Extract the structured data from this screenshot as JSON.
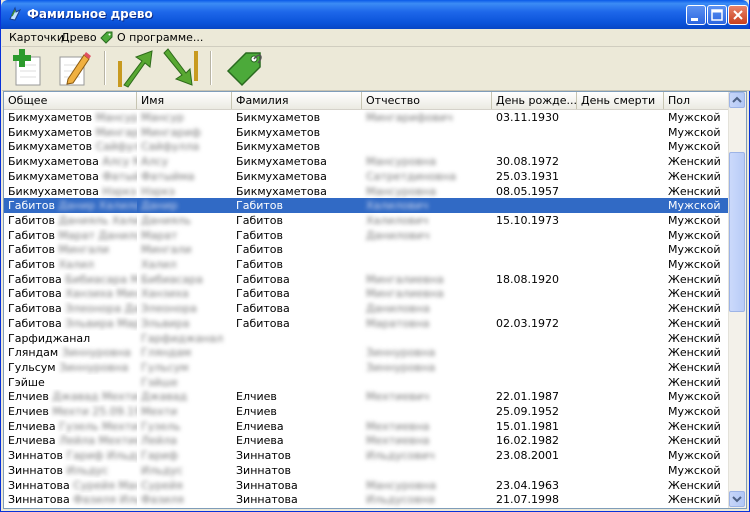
{
  "window": {
    "title": "Фамильное древо",
    "colors": {
      "titlebar": "#0a52d9",
      "selection": "#316ac5"
    }
  },
  "menu": {
    "cards": "Карточки",
    "tree": "Древо",
    "about": "О программе..."
  },
  "toolbar": {
    "buttons": [
      "add-card-icon",
      "edit-card-icon",
      "move-up-icon",
      "move-down-icon",
      "tag-icon"
    ]
  },
  "table": {
    "columns": [
      "Общее",
      "Имя",
      "Фамилия",
      "Отчество",
      "День рожде...",
      "День смерти",
      "Пол"
    ],
    "rows": [
      {
        "general": "Бикмухаметов Мансур",
        "name": "Мансур",
        "surname": "Бикмухаметов",
        "patronymic": "Мингарифович",
        "birth": "03.11.1930",
        "death": "",
        "sex": "Мужской"
      },
      {
        "general": "Бикмухаметов Мингариф",
        "name": "Мингариф",
        "surname": "Бикмухаметов",
        "patronymic": "",
        "birth": "",
        "death": "",
        "sex": "Мужской"
      },
      {
        "general": "Бикмухаметов Сайфулла",
        "name": "Сайфулла",
        "surname": "Бикмухаметов",
        "patronymic": "",
        "birth": "",
        "death": "",
        "sex": "Мужской"
      },
      {
        "general": "Бикмухаметова Алсу Мансуровна",
        "name": "Алсу",
        "surname": "Бикмухаметова",
        "patronymic": "Мансуровна",
        "birth": "30.08.1972",
        "death": "",
        "sex": "Женский"
      },
      {
        "general": "Бикмухаметова Фатыйма",
        "name": "Фатыйма",
        "surname": "Бикмухаметова",
        "patronymic": "Сатретдиновна",
        "birth": "25.03.1931",
        "death": "",
        "sex": "Женский"
      },
      {
        "general": "Бикмухаметова Нэркэ",
        "name": "Нэркэ",
        "surname": "Бикмухаметова",
        "patronymic": "Мансуровна",
        "birth": "08.05.1957",
        "death": "",
        "sex": "Женский"
      },
      {
        "general": "Габитов Данир Халилович",
        "name": "Данир",
        "surname": "Габитов",
        "patronymic": "Халилович",
        "birth": "",
        "death": "",
        "sex": "Мужской"
      },
      {
        "general": "Габитов Данияль Халилович",
        "name": "Данияль",
        "surname": "Габитов",
        "patronymic": "Халилович",
        "birth": "15.10.1973",
        "death": "",
        "sex": "Мужской"
      },
      {
        "general": "Габитов Марат Данилович",
        "name": "Марат",
        "surname": "Габитов",
        "patronymic": "Данилович",
        "birth": "",
        "death": "",
        "sex": "Мужской"
      },
      {
        "general": "Габитов Мингали",
        "name": "Мингали",
        "surname": "Габитов",
        "patronymic": "",
        "birth": "",
        "death": "",
        "sex": "Мужской"
      },
      {
        "general": "Габитов Халил",
        "name": "Халил",
        "surname": "Габитов",
        "patronymic": "",
        "birth": "",
        "death": "",
        "sex": "Мужской"
      },
      {
        "general": "Габитова Бибиасара Мингалиевна",
        "name": "Бибиасара",
        "surname": "Габитова",
        "patronymic": "Мингалиевна",
        "birth": "18.08.1920",
        "death": "",
        "sex": "Женский"
      },
      {
        "general": "Габитова Ханзиха Мингалиевна",
        "name": "Ханзиха",
        "surname": "Габитова",
        "patronymic": "Мингалиевна",
        "birth": "",
        "death": "",
        "sex": "Женский"
      },
      {
        "general": "Габитова Элеонора Даниловна",
        "name": "Элеонора",
        "surname": "Габитова",
        "patronymic": "Даниловна",
        "birth": "",
        "death": "",
        "sex": "Женский"
      },
      {
        "general": "Габитова Эльвира Маратовна",
        "name": "Эльвира",
        "surname": "Габитова",
        "patronymic": "Маратовна",
        "birth": "02.03.1972",
        "death": "",
        "sex": "Женский"
      },
      {
        "general": "Гарфиджанал",
        "name": "Гарфиджанал",
        "surname": "",
        "patronymic": "",
        "birth": "",
        "death": "",
        "sex": "Женский"
      },
      {
        "general": "Гляндам Зиннуровна",
        "name": "Гляндам",
        "surname": "",
        "patronymic": "Зиннуровна",
        "birth": "",
        "death": "",
        "sex": "Женский"
      },
      {
        "general": "Гульсум Зиннуровна",
        "name": "Гульсум",
        "surname": "",
        "patronymic": "Зиннуровна",
        "birth": "",
        "death": "",
        "sex": "Женский"
      },
      {
        "general": "Гэйше",
        "name": "Гэйше",
        "surname": "",
        "patronymic": "",
        "birth": "",
        "death": "",
        "sex": "Женский"
      },
      {
        "general": "Елчиев Джавад Мехтиевич",
        "name": "Джавад",
        "surname": "Елчиев",
        "patronymic": "Мехтиевич",
        "birth": "22.01.1987",
        "death": "",
        "sex": "Мужской"
      },
      {
        "general": "Елчиев Мехти 25.09.1952",
        "name": "Мехти",
        "surname": "Елчиев",
        "patronymic": "",
        "birth": "25.09.1952",
        "death": "",
        "sex": "Мужской"
      },
      {
        "general": "Елчиева Гузель Мехтиевна",
        "name": "Гузель",
        "surname": "Елчиева",
        "patronymic": "Мехтиевна",
        "birth": "15.01.1981",
        "death": "",
        "sex": "Женский"
      },
      {
        "general": "Елчиева Лейла Мехтиевна",
        "name": "Лейла",
        "surname": "Елчиева",
        "patronymic": "Мехтиевна",
        "birth": "16.02.1982",
        "death": "",
        "sex": "Женский"
      },
      {
        "general": "Зиннатов Гариф Ильдусович",
        "name": "Гариф",
        "surname": "Зиннатов",
        "patronymic": "Ильдусович",
        "birth": "23.08.2001",
        "death": "",
        "sex": "Мужской"
      },
      {
        "general": "Зиннатов Ильдус",
        "name": "Ильдус",
        "surname": "Зиннатов",
        "patronymic": "",
        "birth": "",
        "death": "",
        "sex": "Мужской"
      },
      {
        "general": "Зиннатова Сурейя Мансуровна",
        "name": "Сурейя",
        "surname": "Зиннатова",
        "patronymic": "Мансуровна",
        "birth": "23.04.1963",
        "death": "",
        "sex": "Женский"
      },
      {
        "general": "Зиннатова Фазиля Ильдусовна",
        "name": "Фазиля",
        "surname": "Зиннатова",
        "patronymic": "Ильдусовна",
        "birth": "21.07.1998",
        "death": "",
        "sex": "Женский"
      }
    ],
    "selected_index": 6
  }
}
